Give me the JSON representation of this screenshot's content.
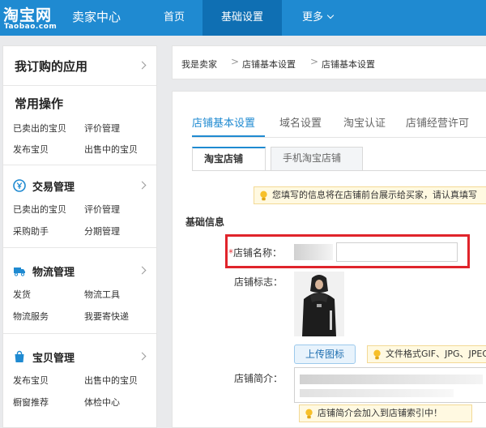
{
  "header": {
    "logo_main": "淘宝网",
    "logo_sub": "Taobao.com",
    "site_name": "卖家中心",
    "nav": [
      {
        "label": "首页"
      },
      {
        "label": "基础设置"
      },
      {
        "label": "更多"
      }
    ]
  },
  "sidebar": {
    "apps_title": "我订购的应用",
    "common_title": "常用操作",
    "common_links": [
      "已卖出的宝贝",
      "评价管理",
      "发布宝贝",
      "出售中的宝贝"
    ],
    "groups": [
      {
        "title": "交易管理",
        "icon": "yen-icon",
        "links": [
          "已卖出的宝贝",
          "评价管理",
          "采购助手",
          "分期管理"
        ]
      },
      {
        "title": "物流管理",
        "icon": "truck-icon",
        "links": [
          "发货",
          "物流工具",
          "物流服务",
          "我要寄快递"
        ]
      },
      {
        "title": "宝贝管理",
        "icon": "bag-icon",
        "links": [
          "发布宝贝",
          "出售中的宝贝",
          "橱窗推荐",
          "体检中心"
        ]
      }
    ]
  },
  "breadcrumb": [
    "我是卖家",
    "店铺基本设置",
    "店铺基本设置"
  ],
  "main": {
    "tabs": [
      "店铺基本设置",
      "域名设置",
      "淘宝认证",
      "店铺经营许可"
    ],
    "subtabs": [
      "淘宝店铺",
      "手机淘宝店铺"
    ],
    "notice": "您填写的信息将在店铺前台展示给买家，请认真填写",
    "section_title": "基础信息",
    "shop_name_label": "*店铺名称：",
    "shop_logo_label": "店铺标志：",
    "upload_button": "上传图标",
    "upload_tip": "文件格式GIF、JPG、JPEG、PNG",
    "intro_label": "店铺简介：",
    "intro_tip": "店铺简介会加入到店铺索引中！"
  },
  "colors": {
    "brand_blue": "#1f8ad1",
    "nav_active": "#0f6fb3",
    "highlight_red": "#e0242b",
    "tip_background": "#fff9e1"
  }
}
